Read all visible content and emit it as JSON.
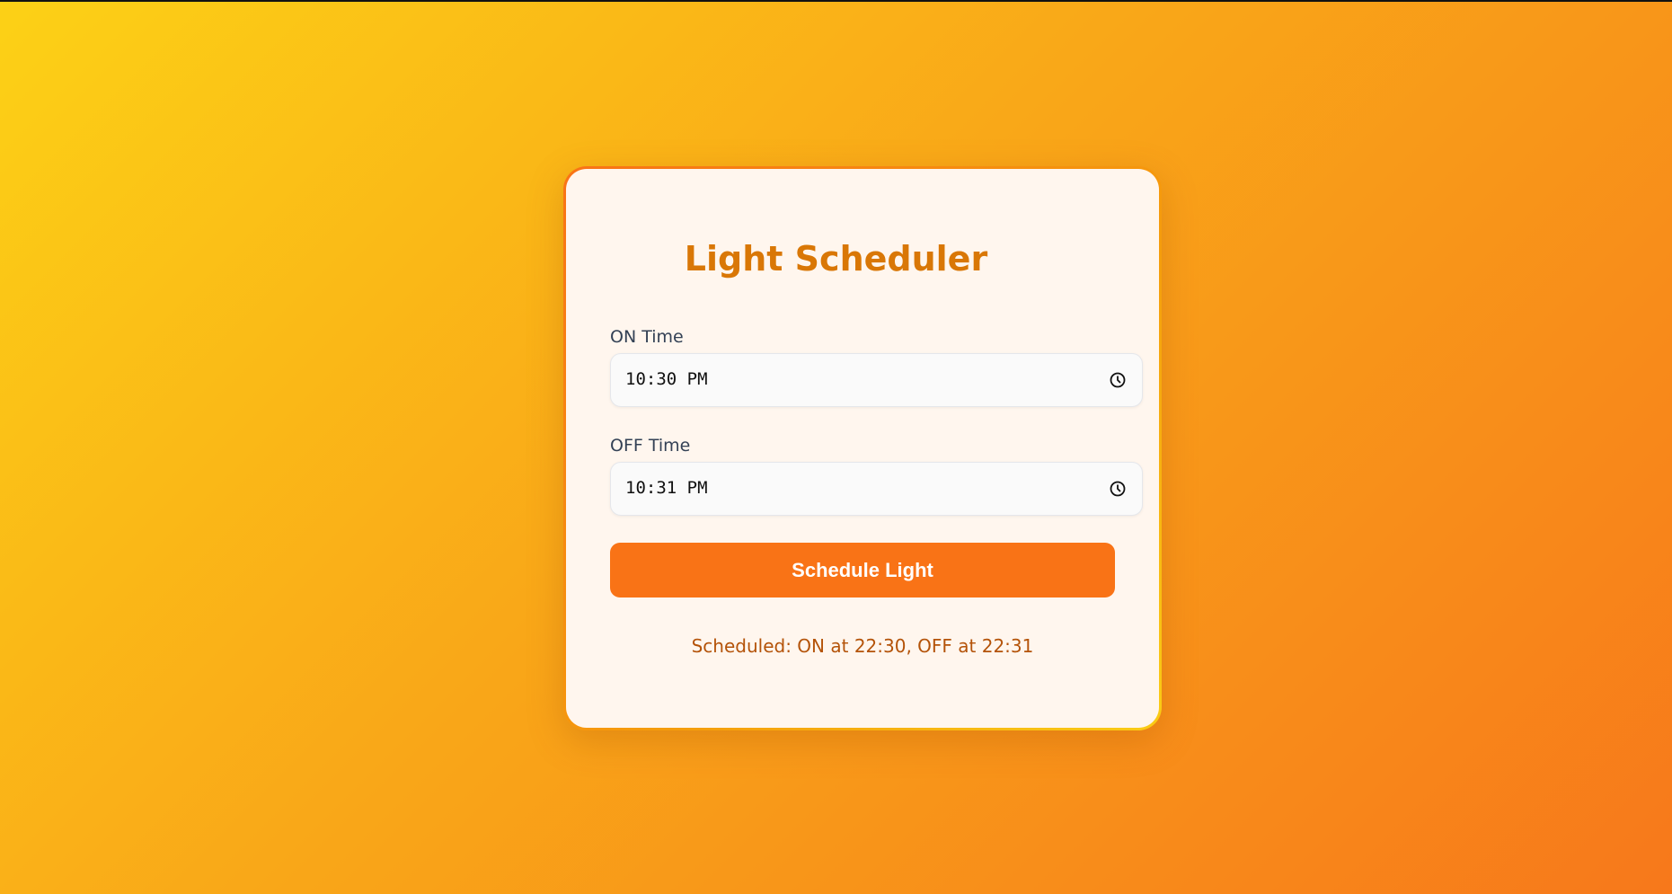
{
  "title": "Light Scheduler",
  "on_time": {
    "label": "ON Time",
    "value": "10:30 PM",
    "icon": "clock-icon"
  },
  "off_time": {
    "label": "OFF Time",
    "value": "10:31 PM",
    "icon": "clock-icon"
  },
  "button_label": "Schedule Light",
  "status": "Scheduled: ON at 22:30, OFF at 22:31",
  "colors": {
    "accent": "#f97316",
    "title": "#d97706",
    "status": "#b45309",
    "card": "#fff6ee"
  }
}
